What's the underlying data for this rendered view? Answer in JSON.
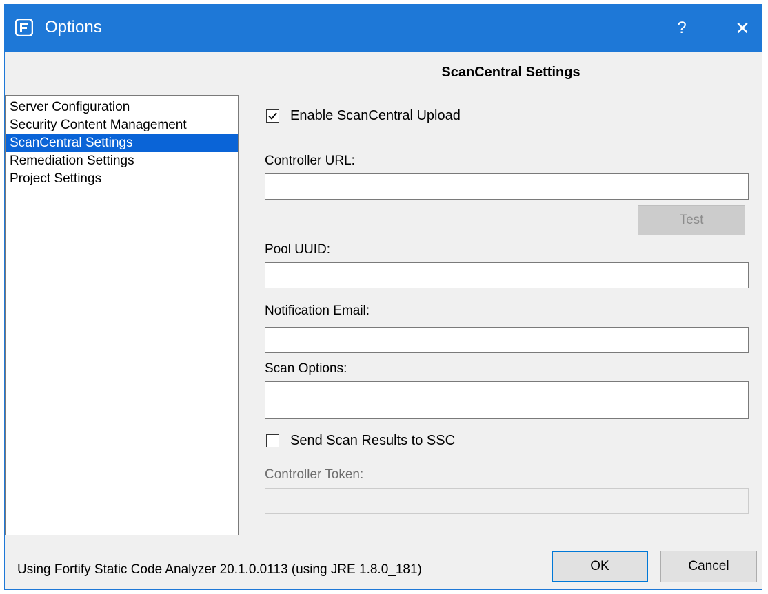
{
  "window": {
    "title": "Options",
    "help_glyph": "?",
    "close_glyph": "✕",
    "accent_color": "#1e78d7"
  },
  "sidebar": {
    "items": [
      {
        "label": "Server Configuration",
        "selected": false
      },
      {
        "label": "Security Content Management",
        "selected": false
      },
      {
        "label": "ScanCentral Settings",
        "selected": true
      },
      {
        "label": "Remediation Settings",
        "selected": false
      },
      {
        "label": "Project Settings",
        "selected": false
      }
    ]
  },
  "panel": {
    "title": "ScanCentral Settings",
    "enable_upload": {
      "label": "Enable ScanCentral Upload",
      "checked": true
    },
    "controller_url": {
      "label": "Controller URL:",
      "value": ""
    },
    "test_button": "Test",
    "pool_uuid": {
      "label": "Pool UUID:",
      "value": ""
    },
    "notification_email": {
      "label": "Notification Email:",
      "value": ""
    },
    "scan_options": {
      "label": "Scan Options:",
      "value": ""
    },
    "send_results": {
      "label": "Send Scan Results to SSC",
      "checked": false
    },
    "controller_token": {
      "label": "Controller Token:",
      "value": ""
    }
  },
  "footer": {
    "status": "Using Fortify Static Code Analyzer 20.1.0.0113 (using JRE 1.8.0_181)",
    "ok_label": "OK",
    "cancel_label": "Cancel"
  }
}
